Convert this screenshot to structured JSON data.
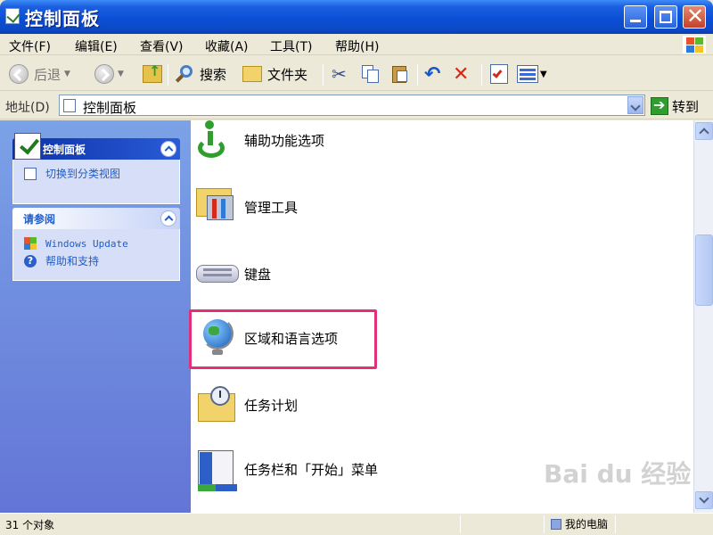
{
  "window": {
    "title": "控制面板"
  },
  "menu": [
    "文件(F)",
    "编辑(E)",
    "查看(V)",
    "收藏(A)",
    "工具(T)",
    "帮助(H)"
  ],
  "toolbar": {
    "back": "后退",
    "search": "搜索",
    "folders": "文件夹"
  },
  "address": {
    "label": "地址(D)",
    "value": "控制面板",
    "go": "转到"
  },
  "sidebar": {
    "panel1": {
      "title": "控制面板",
      "link": "切换到分类视图"
    },
    "panel2": {
      "title": "请参阅",
      "links": [
        "Windows Update",
        "帮助和支持"
      ]
    }
  },
  "items": [
    {
      "label": "辅助功能选项",
      "icon": "accessibility-icon"
    },
    {
      "label": "管理工具",
      "icon": "admin-tools-icon"
    },
    {
      "label": "键盘",
      "icon": "keyboard-icon"
    },
    {
      "label": "区域和语言选项",
      "icon": "globe-icon"
    },
    {
      "label": "任务计划",
      "icon": "scheduled-tasks-icon"
    },
    {
      "label": "任务栏和「开始」菜单",
      "icon": "taskbar-icon"
    }
  ],
  "status": {
    "count": "31 个对象",
    "location": "我的电脑"
  },
  "watermark": "Bai du 经验"
}
